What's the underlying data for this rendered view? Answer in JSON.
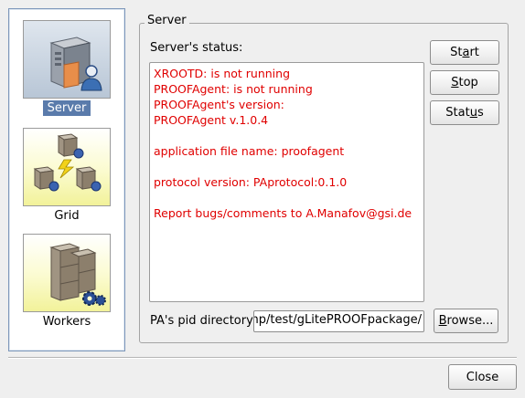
{
  "nav": {
    "items": [
      {
        "label": "Server",
        "icon": "server-user-icon",
        "selected": true
      },
      {
        "label": "Grid",
        "icon": "grid-servers-icon",
        "selected": false
      },
      {
        "label": "Workers",
        "icon": "workers-cluster-icon",
        "selected": false
      }
    ]
  },
  "server": {
    "group_title": "Server",
    "status_label": "Server's status:",
    "status_lines": [
      "XROOTD: is not running",
      "PROOFAgent: is not running",
      "PROOFAgent's version:",
      "PROOFAgent v.1.0.4",
      "",
      "application file name: proofagent",
      "",
      "protocol version: PAprotocol:0.1.0",
      "",
      "Report bugs/comments to A.Manafov@gsi.de"
    ],
    "status_text_color": "#e00000",
    "buttons": {
      "start": {
        "pre": "St",
        "mnemonic": "a",
        "post": "rt"
      },
      "stop": {
        "pre": "",
        "mnemonic": "S",
        "post": "top"
      },
      "status": {
        "pre": "Stat",
        "mnemonic": "u",
        "post": "s"
      }
    },
    "pid_label": "PA's pid directory:",
    "pid_value": "/tmp/test/gLitePROOFpackage/",
    "browse": {
      "pre": "",
      "mnemonic": "B",
      "post": "rowse..."
    }
  },
  "footer": {
    "close_label": "Close"
  },
  "colors": {
    "selection": "#5a7bab",
    "nav_border": "#7d97ba"
  }
}
